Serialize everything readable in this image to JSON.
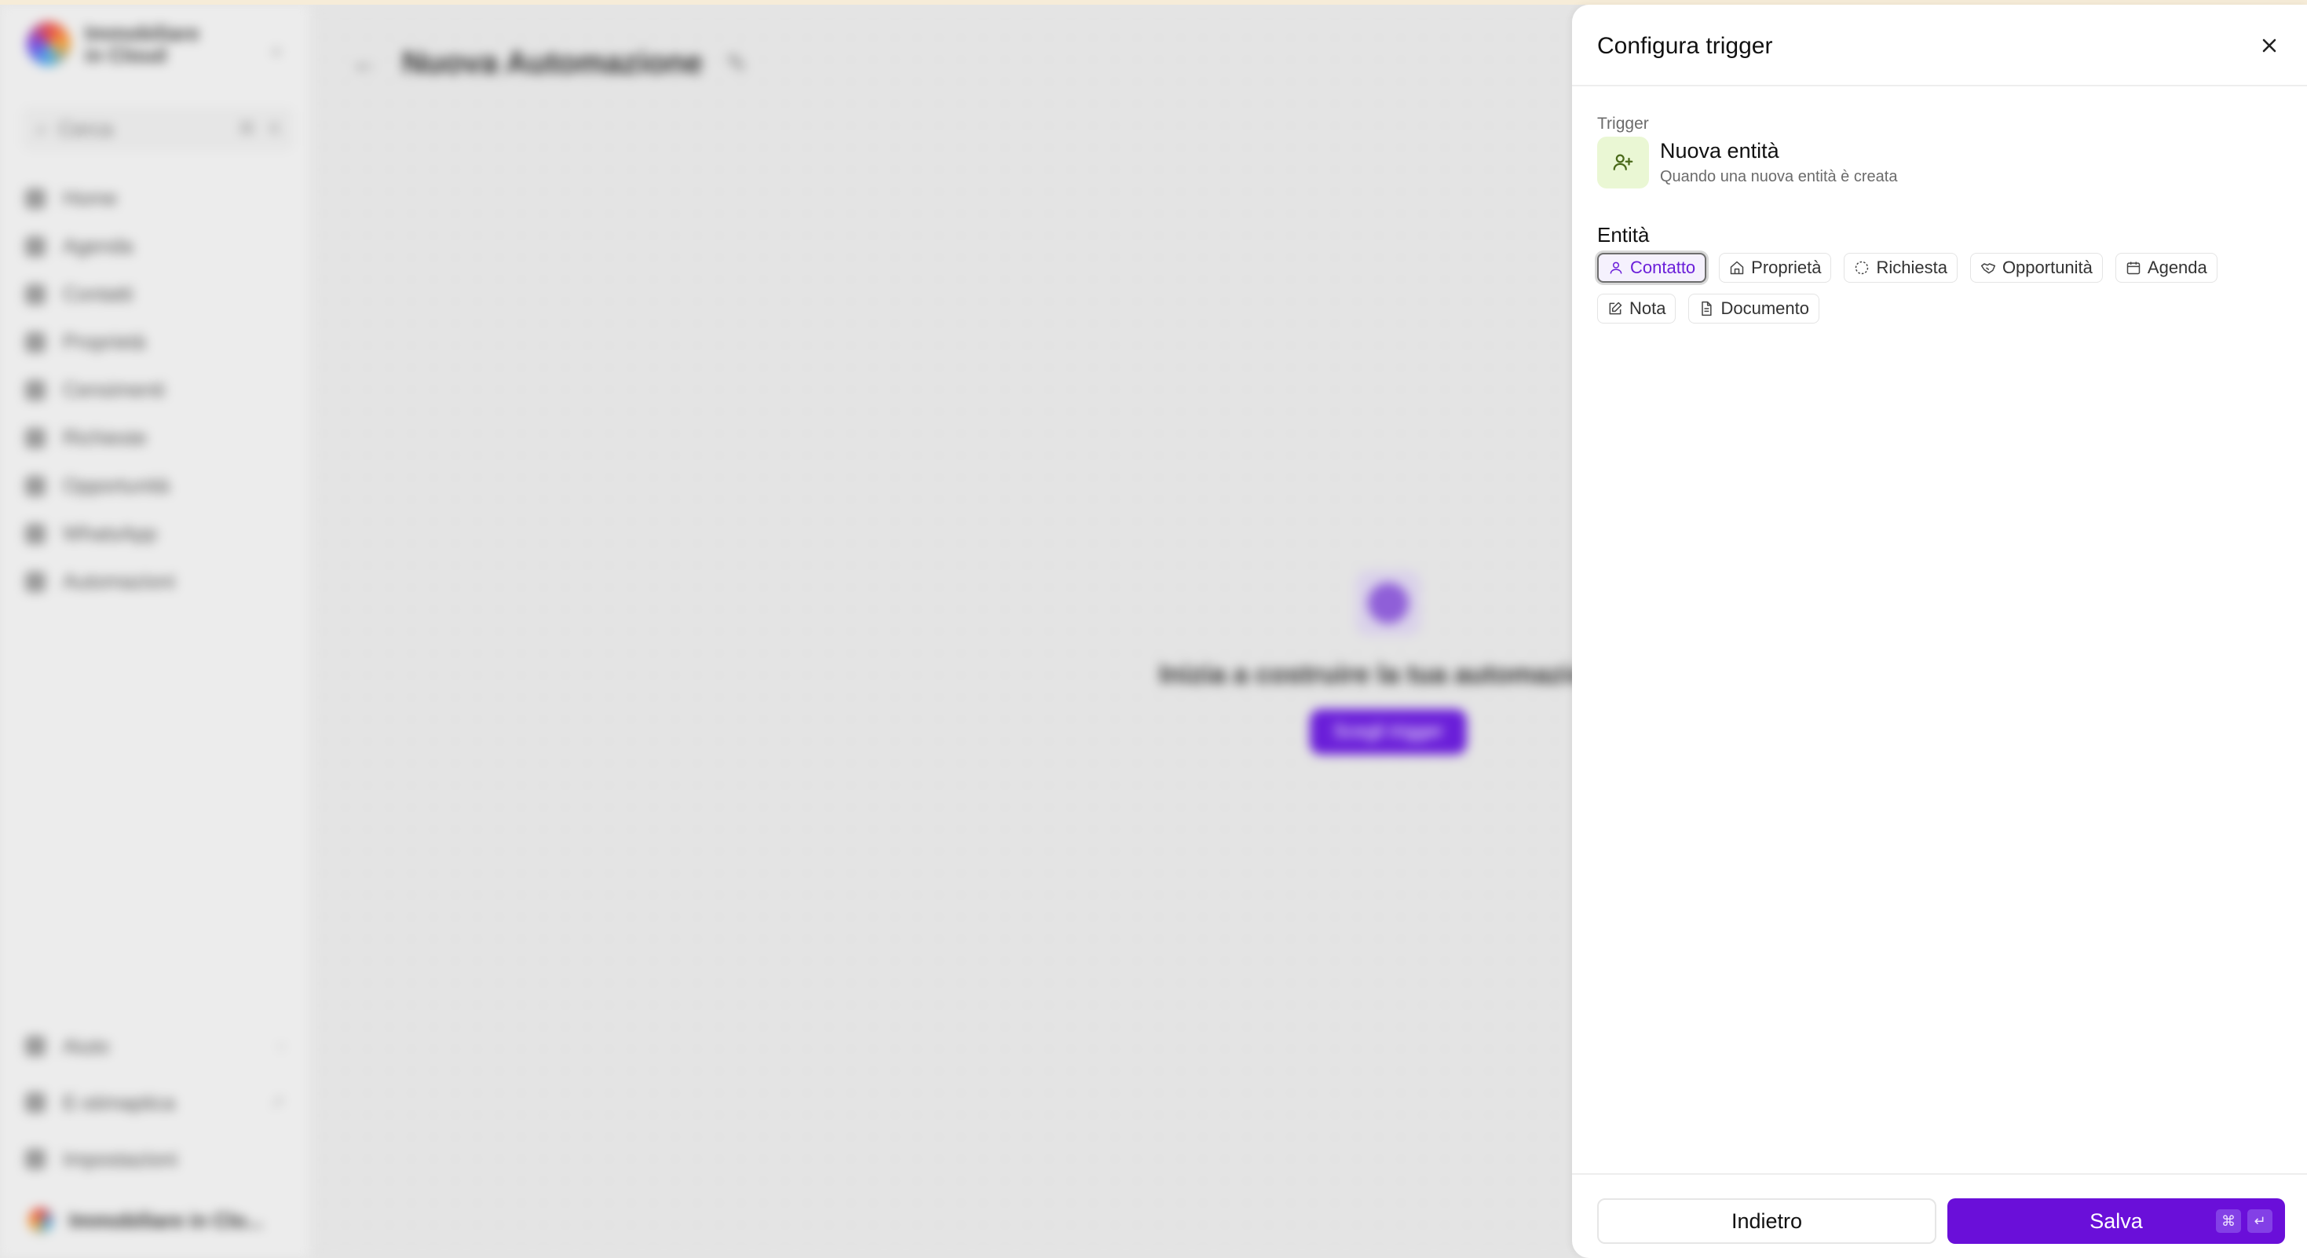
{
  "app": {
    "logo_text": "Immobiliare in Cloud",
    "search": {
      "label": "Cerca",
      "shortcut_1": "⌘",
      "shortcut_2": "K"
    },
    "nav": [
      {
        "label": "Home",
        "icon": "home-icon"
      },
      {
        "label": "Agenda",
        "icon": "calendar-icon"
      },
      {
        "label": "Contatti",
        "icon": "user-icon"
      },
      {
        "label": "Proprietà",
        "icon": "building-icon"
      },
      {
        "label": "Censimenti",
        "icon": "people-icon"
      },
      {
        "label": "Richieste",
        "icon": "dashed-circle-icon"
      },
      {
        "label": "Opportunità",
        "icon": "handshake-icon"
      },
      {
        "label": "WhatsApp",
        "icon": "whatsapp-icon"
      },
      {
        "label": "Automazioni",
        "icon": "automation-icon"
      }
    ],
    "bottom_nav": [
      {
        "label": "Aiuto",
        "aux": "›"
      },
      {
        "label": "E-stimaptica",
        "aux": "↗"
      },
      {
        "label": "Impostazioni",
        "aux": ""
      }
    ],
    "account": "Immobiliare in Clo...",
    "page_title": "Nuova Automazione",
    "empty_title": "Inizia a costruire la tua automazione",
    "empty_button": "Scegli trigger"
  },
  "panel": {
    "title": "Configura trigger",
    "trigger_label": "Trigger",
    "trigger_name": "Nuova entità",
    "trigger_desc": "Quando una nuova entità è creata",
    "entity_label": "Entità",
    "chips": [
      {
        "label": "Contatto",
        "icon": "user-icon",
        "active": true
      },
      {
        "label": "Proprietà",
        "icon": "home-icon",
        "active": false
      },
      {
        "label": "Richiesta",
        "icon": "dashed-circle-icon",
        "active": false
      },
      {
        "label": "Opportunità",
        "icon": "handshake-icon",
        "active": false
      },
      {
        "label": "Agenda",
        "icon": "calendar-icon",
        "active": false
      },
      {
        "label": "Nota",
        "icon": "edit-note-icon",
        "active": false
      },
      {
        "label": "Documento",
        "icon": "document-icon",
        "active": false
      }
    ],
    "back_label": "Indietro",
    "save_label": "Salva",
    "save_shortcut": [
      "⌘",
      "↵"
    ]
  },
  "colors": {
    "accent": "#6a0fd9",
    "trigger_icon_bg": "#eaf7d4",
    "backdrop": "#e5e5e5"
  }
}
